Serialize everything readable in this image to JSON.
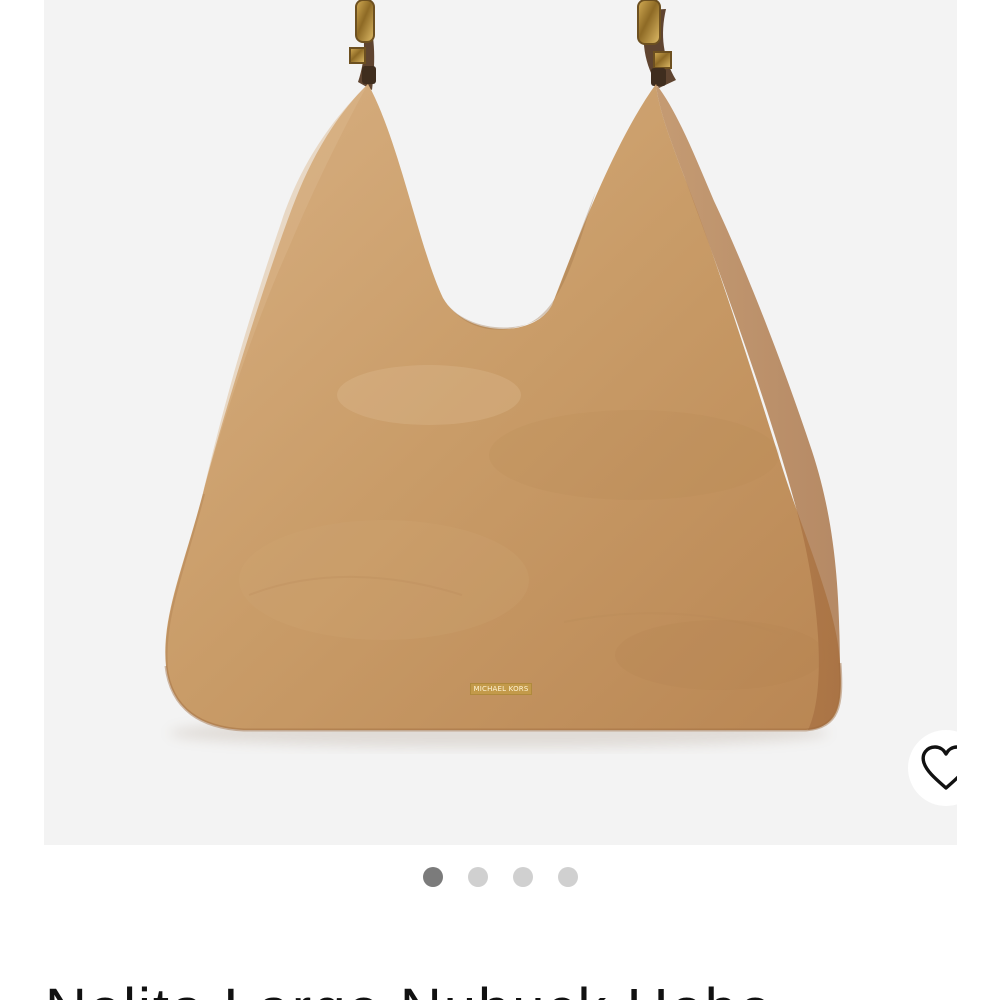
{
  "product": {
    "title": "Nolita Large Nubuck Hobo",
    "brand_logo_text": "MICHAEL KORS",
    "color": "#c79b67"
  },
  "gallery": {
    "total_images": 4,
    "active_index": 1
  },
  "icons": {
    "wishlist": "heart-icon"
  },
  "colors": {
    "image_background": "#f3f3f3",
    "dot_active": "#7b7b7b",
    "dot_inactive": "#d0d0d0"
  }
}
